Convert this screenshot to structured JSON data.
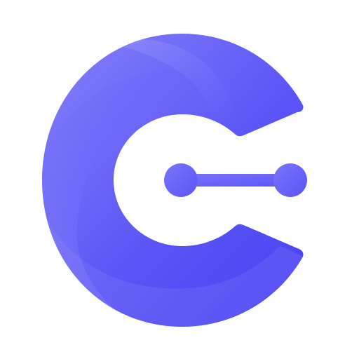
{
  "logo": {
    "icon": "c-connector-logo-icon",
    "colors": {
      "primary": "#5b56f6",
      "light": "#8b86fb",
      "dark": "#4a44f2",
      "background": "#ffffff"
    }
  }
}
